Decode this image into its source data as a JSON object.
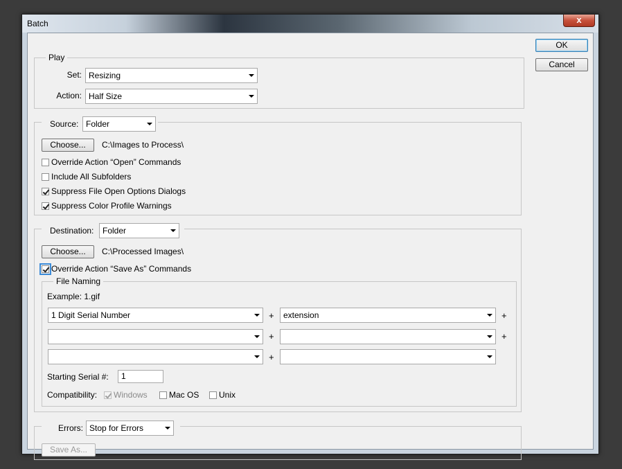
{
  "window": {
    "title": "Batch",
    "close_glyph": "x"
  },
  "buttons": {
    "ok": "OK",
    "cancel": "Cancel"
  },
  "play": {
    "legend": "Play",
    "set_label": "Set:",
    "set_value": "Resizing",
    "action_label": "Action:",
    "action_value": "Half Size"
  },
  "source": {
    "label": "Source:",
    "value": "Folder",
    "choose": "Choose...",
    "path": "C:\\Images to Process\\",
    "options": [
      {
        "label": "Override Action “Open” Commands",
        "checked": false
      },
      {
        "label": "Include All Subfolders",
        "checked": false
      },
      {
        "label": "Suppress File Open Options Dialogs",
        "checked": true
      },
      {
        "label": "Suppress Color Profile Warnings",
        "checked": true
      }
    ]
  },
  "destination": {
    "label": "Destination:",
    "value": "Folder",
    "choose": "Choose...",
    "path": "C:\\Processed Images\\",
    "override_label": "Override Action “Save As” Commands",
    "override_checked": true
  },
  "file_naming": {
    "legend": "File Naming",
    "example": "Example: 1.gif",
    "rows": [
      {
        "left": "1 Digit Serial Number",
        "right": "extension"
      },
      {
        "left": "",
        "right": ""
      },
      {
        "left": "",
        "right": ""
      }
    ],
    "plus": "+",
    "serial_label": "Starting Serial #:",
    "serial_value": "1",
    "compat_label": "Compatibility:",
    "compat": [
      {
        "label": "Windows",
        "checked": true,
        "disabled": true
      },
      {
        "label": "Mac OS",
        "checked": false,
        "disabled": false
      },
      {
        "label": "Unix",
        "checked": false,
        "disabled": false
      }
    ]
  },
  "errors": {
    "label": "Errors:",
    "value": "Stop for Errors",
    "save_as": "Save As..."
  }
}
